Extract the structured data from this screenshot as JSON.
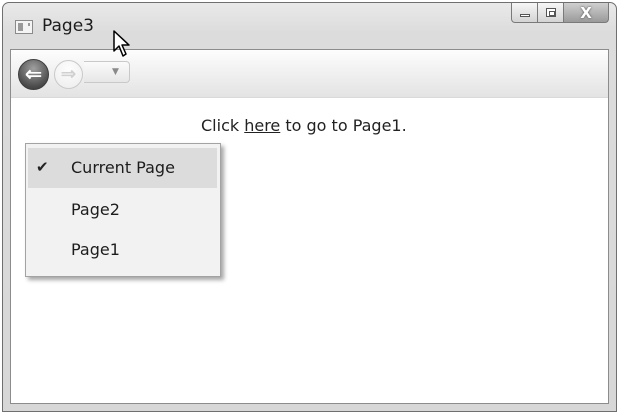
{
  "window": {
    "title": "Page3",
    "caption_buttons": {
      "minimize_icon": "minimize-icon",
      "maximize_icon": "maximize-icon",
      "close_glyph": "X"
    }
  },
  "navigation": {
    "back_icon": "back-arrow-icon",
    "forward_icon": "forward-arrow-icon",
    "dropdown_icon": "chevron-down-icon",
    "back_glyph": "⇐",
    "forward_glyph": "⇒",
    "dropdown_glyph": "▼"
  },
  "history_menu": {
    "items": [
      {
        "label": "Current Page",
        "checked": true,
        "check_glyph": "✔"
      },
      {
        "label": "Page2",
        "checked": false
      },
      {
        "label": "Page1",
        "checked": false
      }
    ]
  },
  "content": {
    "prefix": "Click ",
    "link_text": "here",
    "suffix": " to go to Page1."
  }
}
